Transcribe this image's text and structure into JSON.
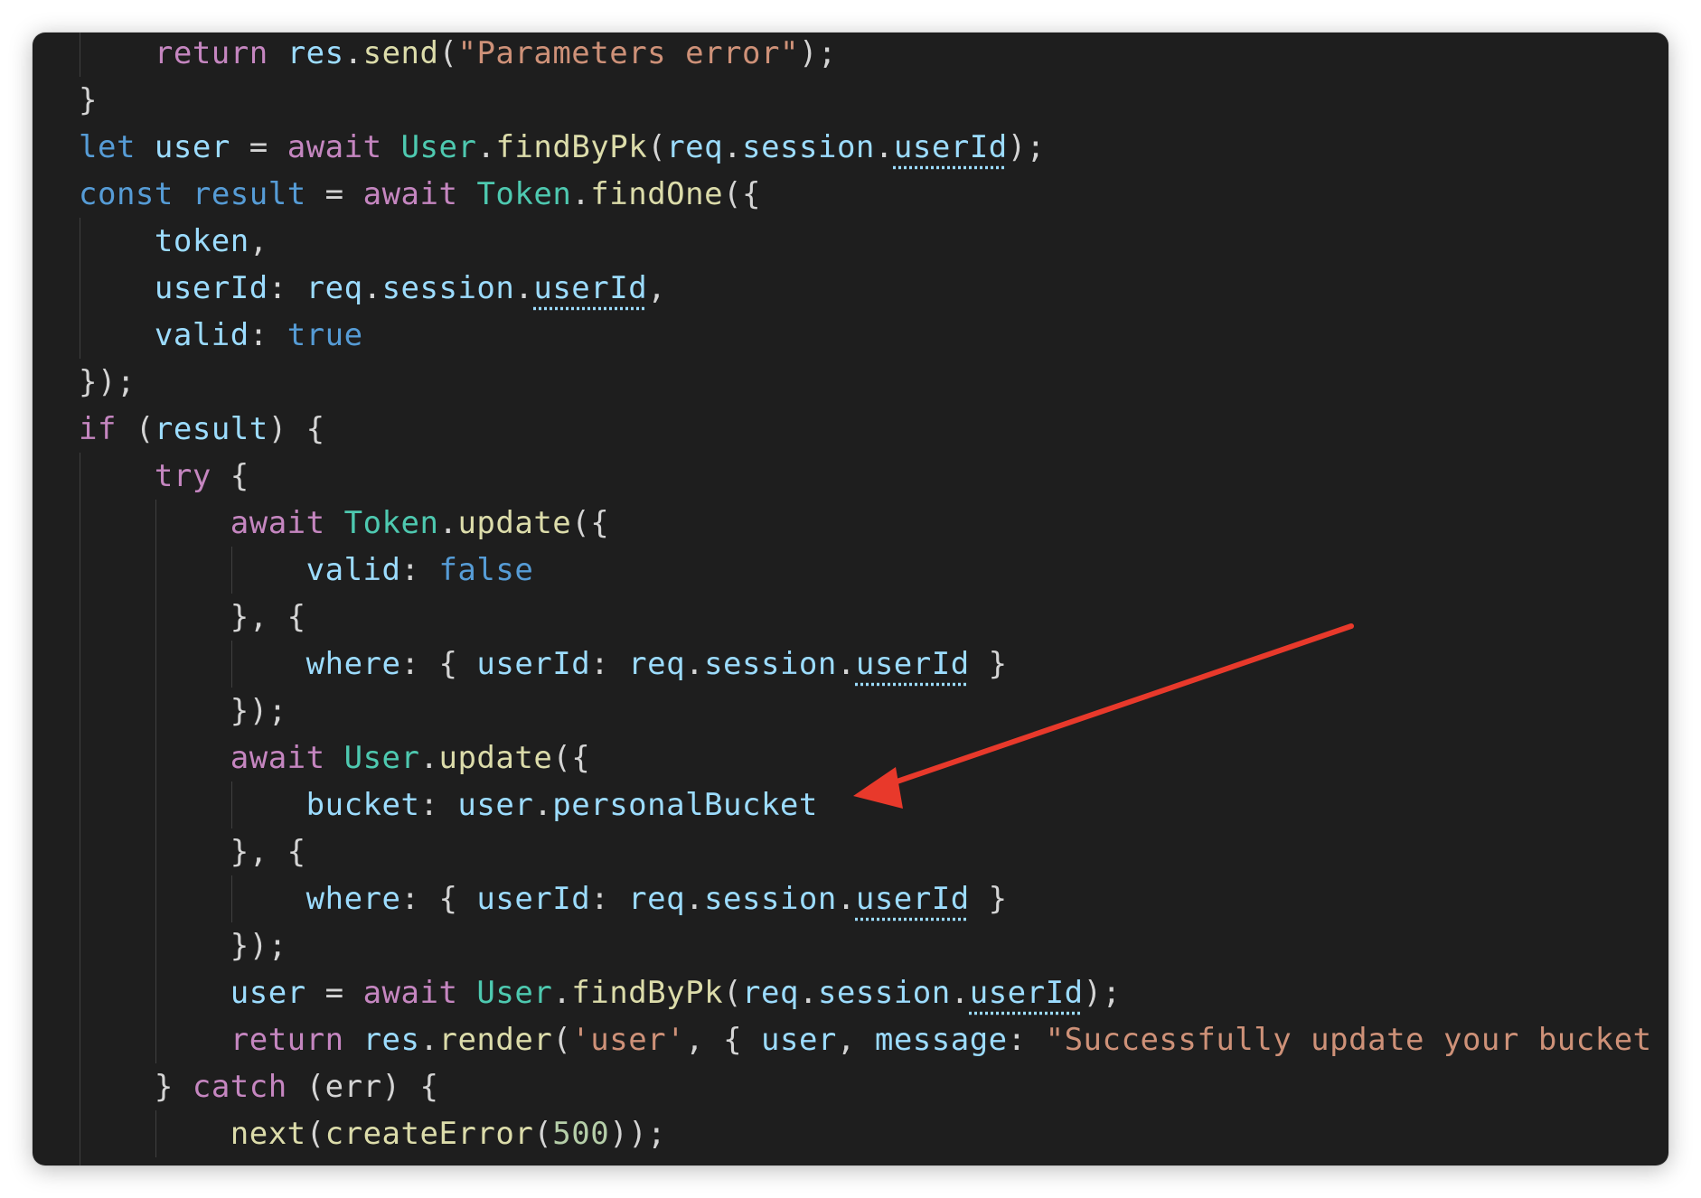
{
  "colors": {
    "editor_bg": "#1e1e1e",
    "keyword": "#c586c0",
    "storage": "#569cd6",
    "function": "#dcdcaa",
    "class": "#4ec9b0",
    "variable": "#9cdcfe",
    "string": "#ce9178",
    "number": "#b5cea8",
    "punctuation": "#d4d4d4",
    "annotation_arrow": "#e8392b"
  },
  "code": {
    "lines": [
      {
        "indent": 1,
        "tokens": [
          {
            "t": "return",
            "c": "kw"
          },
          {
            "t": " "
          },
          {
            "t": "res",
            "c": "vr"
          },
          {
            "t": "."
          },
          {
            "t": "send",
            "c": "fn"
          },
          {
            "t": "("
          },
          {
            "t": "\"Parameters error\"",
            "c": "s"
          },
          {
            "t": ");"
          }
        ]
      },
      {
        "indent": 0,
        "tokens": [
          {
            "t": "}"
          }
        ]
      },
      {
        "indent": 0,
        "tokens": [
          {
            "t": "let",
            "c": "st"
          },
          {
            "t": " "
          },
          {
            "t": "user",
            "c": "vr"
          },
          {
            "t": " = "
          },
          {
            "t": "await",
            "c": "kw"
          },
          {
            "t": " "
          },
          {
            "t": "User",
            "c": "cl"
          },
          {
            "t": "."
          },
          {
            "t": "findByPk",
            "c": "fn"
          },
          {
            "t": "("
          },
          {
            "t": "req",
            "c": "vr"
          },
          {
            "t": "."
          },
          {
            "t": "session",
            "c": "vr"
          },
          {
            "t": "."
          },
          {
            "t": "userId",
            "c": "vr",
            "hint": true
          },
          {
            "t": ");"
          }
        ]
      },
      {
        "indent": 0,
        "tokens": [
          {
            "t": "const",
            "c": "st"
          },
          {
            "t": " "
          },
          {
            "t": "result",
            "c": "st"
          },
          {
            "t": " = "
          },
          {
            "t": "await",
            "c": "kw"
          },
          {
            "t": " "
          },
          {
            "t": "Token",
            "c": "cl"
          },
          {
            "t": "."
          },
          {
            "t": "findOne",
            "c": "fn"
          },
          {
            "t": "({"
          }
        ]
      },
      {
        "indent": 1,
        "tokens": [
          {
            "t": "token",
            "c": "vr"
          },
          {
            "t": ","
          }
        ]
      },
      {
        "indent": 1,
        "tokens": [
          {
            "t": "userId",
            "c": "vr"
          },
          {
            "t": ": "
          },
          {
            "t": "req",
            "c": "vr"
          },
          {
            "t": "."
          },
          {
            "t": "session",
            "c": "vr"
          },
          {
            "t": "."
          },
          {
            "t": "userId",
            "c": "vr",
            "hint": true
          },
          {
            "t": ","
          }
        ]
      },
      {
        "indent": 1,
        "tokens": [
          {
            "t": "valid",
            "c": "vr"
          },
          {
            "t": ": "
          },
          {
            "t": "true",
            "c": "st"
          }
        ]
      },
      {
        "indent": 0,
        "tokens": [
          {
            "t": "});"
          }
        ]
      },
      {
        "indent": 0,
        "tokens": [
          {
            "t": "if",
            "c": "kw"
          },
          {
            "t": " ("
          },
          {
            "t": "result",
            "c": "vr"
          },
          {
            "t": ") {"
          }
        ]
      },
      {
        "indent": 1,
        "tokens": [
          {
            "t": "try",
            "c": "kw"
          },
          {
            "t": " {"
          }
        ]
      },
      {
        "indent": 2,
        "tokens": [
          {
            "t": "await",
            "c": "kw"
          },
          {
            "t": " "
          },
          {
            "t": "Token",
            "c": "cl"
          },
          {
            "t": "."
          },
          {
            "t": "update",
            "c": "fn"
          },
          {
            "t": "({"
          }
        ]
      },
      {
        "indent": 3,
        "tokens": [
          {
            "t": "valid",
            "c": "vr"
          },
          {
            "t": ": "
          },
          {
            "t": "false",
            "c": "st"
          }
        ]
      },
      {
        "indent": 2,
        "tokens": [
          {
            "t": "}, {"
          }
        ]
      },
      {
        "indent": 3,
        "tokens": [
          {
            "t": "where",
            "c": "vr"
          },
          {
            "t": ": { "
          },
          {
            "t": "userId",
            "c": "vr"
          },
          {
            "t": ": "
          },
          {
            "t": "req",
            "c": "vr"
          },
          {
            "t": "."
          },
          {
            "t": "session",
            "c": "vr"
          },
          {
            "t": "."
          },
          {
            "t": "userId",
            "c": "vr",
            "hint": true
          },
          {
            "t": " }"
          }
        ]
      },
      {
        "indent": 2,
        "tokens": [
          {
            "t": "});"
          }
        ]
      },
      {
        "indent": 2,
        "tokens": [
          {
            "t": "await",
            "c": "kw"
          },
          {
            "t": " "
          },
          {
            "t": "User",
            "c": "cl"
          },
          {
            "t": "."
          },
          {
            "t": "update",
            "c": "fn"
          },
          {
            "t": "({"
          }
        ]
      },
      {
        "indent": 3,
        "tokens": [
          {
            "t": "bucket",
            "c": "vr"
          },
          {
            "t": ": "
          },
          {
            "t": "user",
            "c": "vr"
          },
          {
            "t": "."
          },
          {
            "t": "personalBucket",
            "c": "vr"
          }
        ]
      },
      {
        "indent": 2,
        "tokens": [
          {
            "t": "}, {"
          }
        ]
      },
      {
        "indent": 3,
        "tokens": [
          {
            "t": "where",
            "c": "vr"
          },
          {
            "t": ": { "
          },
          {
            "t": "userId",
            "c": "vr"
          },
          {
            "t": ": "
          },
          {
            "t": "req",
            "c": "vr"
          },
          {
            "t": "."
          },
          {
            "t": "session",
            "c": "vr"
          },
          {
            "t": "."
          },
          {
            "t": "userId",
            "c": "vr",
            "hint": true
          },
          {
            "t": " }"
          }
        ]
      },
      {
        "indent": 2,
        "tokens": [
          {
            "t": "});"
          }
        ]
      },
      {
        "indent": 2,
        "tokens": [
          {
            "t": "user",
            "c": "vr"
          },
          {
            "t": " = "
          },
          {
            "t": "await",
            "c": "kw"
          },
          {
            "t": " "
          },
          {
            "t": "User",
            "c": "cl"
          },
          {
            "t": "."
          },
          {
            "t": "findByPk",
            "c": "fn"
          },
          {
            "t": "("
          },
          {
            "t": "req",
            "c": "vr"
          },
          {
            "t": "."
          },
          {
            "t": "session",
            "c": "vr"
          },
          {
            "t": "."
          },
          {
            "t": "userId",
            "c": "vr",
            "hint": true
          },
          {
            "t": ");"
          }
        ]
      },
      {
        "indent": 2,
        "tokens": [
          {
            "t": "return",
            "c": "kw"
          },
          {
            "t": " "
          },
          {
            "t": "res",
            "c": "vr"
          },
          {
            "t": "."
          },
          {
            "t": "render",
            "c": "fn"
          },
          {
            "t": "("
          },
          {
            "t": "'user'",
            "c": "s"
          },
          {
            "t": ", { "
          },
          {
            "t": "user",
            "c": "vr"
          },
          {
            "t": ", "
          },
          {
            "t": "message",
            "c": "vr"
          },
          {
            "t": ": "
          },
          {
            "t": "\"Successfully update your bucket fr",
            "c": "s"
          }
        ]
      },
      {
        "indent": 1,
        "tokens": [
          {
            "t": "} "
          },
          {
            "t": "catch",
            "c": "kw"
          },
          {
            "t": " (err) {"
          }
        ]
      },
      {
        "indent": 2,
        "tokens": [
          {
            "t": "next",
            "c": "fn"
          },
          {
            "t": "("
          },
          {
            "t": "createError",
            "c": "fn"
          },
          {
            "t": "("
          },
          {
            "t": "500",
            "c": "nm"
          },
          {
            "t": "));"
          }
        ]
      },
      {
        "indent": 1,
        "tokens": [
          {
            "t": "}"
          }
        ]
      }
    ]
  }
}
